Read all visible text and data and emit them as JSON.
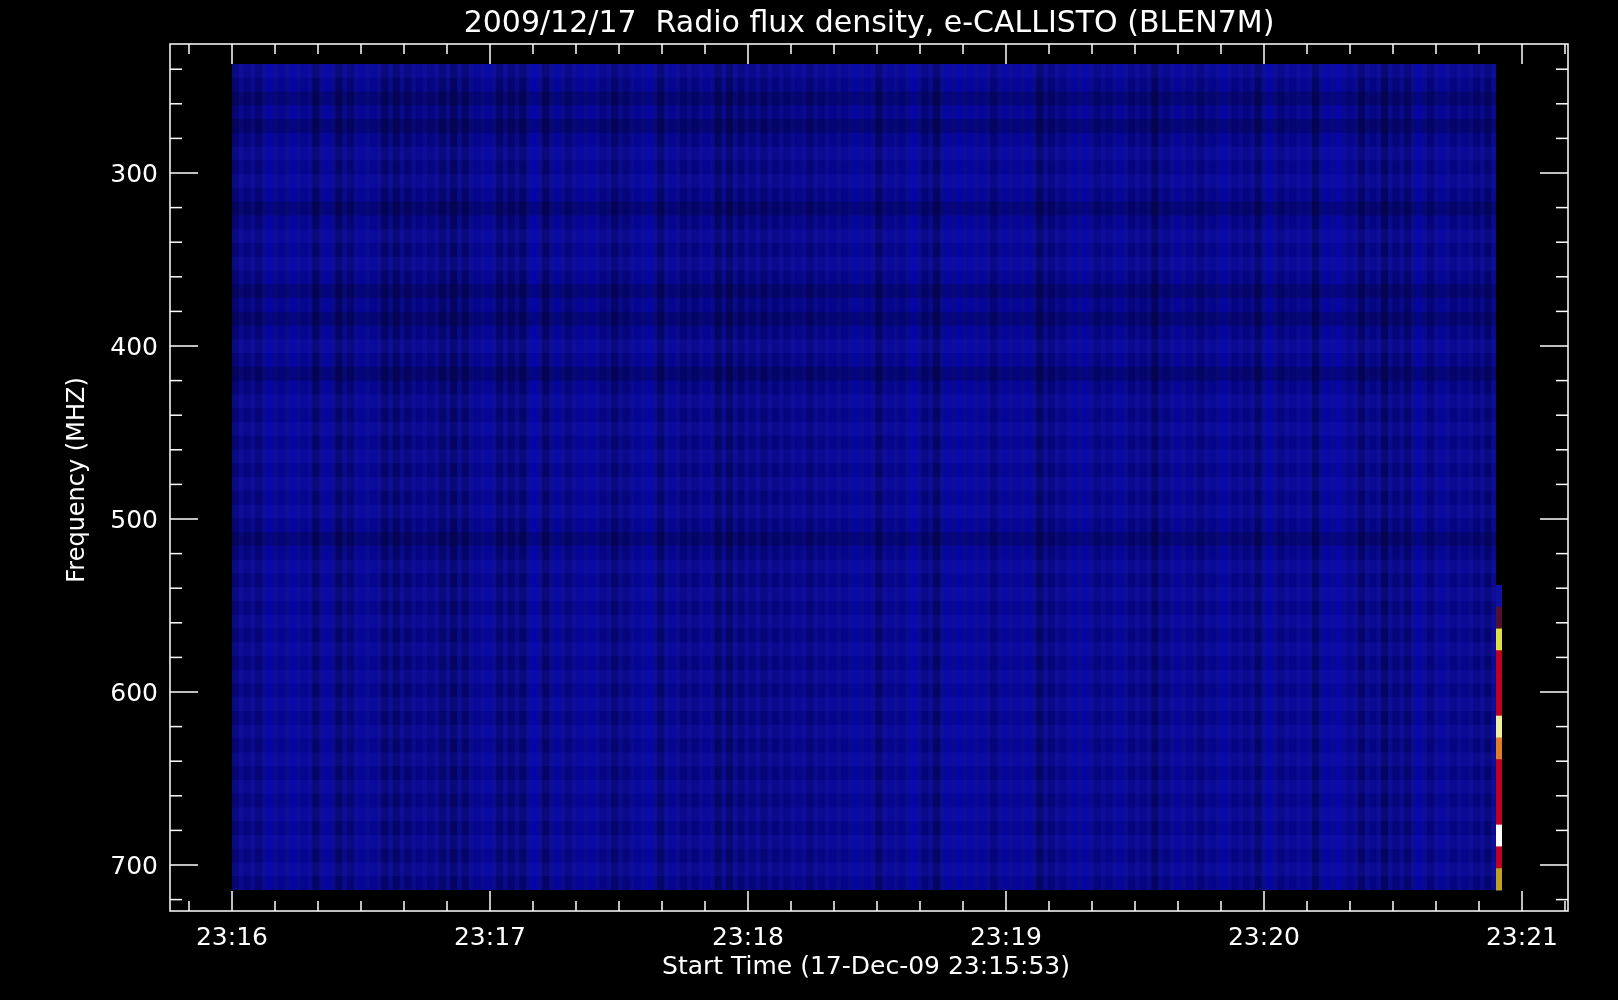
{
  "title": "2009/12/17  Radio flux density, e-CALLISTO (BLEN7M)",
  "y_axis": {
    "label": "Frequency (MHZ)",
    "ticks": [
      "300",
      "400",
      "500",
      "600",
      "700"
    ]
  },
  "x_axis": {
    "label": "Start Time (17-Dec-09 23:15:53)",
    "ticks": [
      "23:16",
      "23:17",
      "23:18",
      "23:19",
      "23:20",
      "23:21"
    ]
  }
}
